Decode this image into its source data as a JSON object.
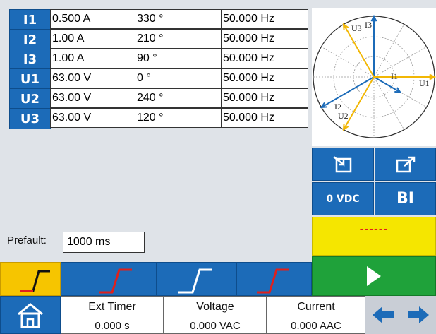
{
  "channels": [
    {
      "name": "I1",
      "magnitude": "0.500 A",
      "angle": "330 °",
      "frequency": "50.000 Hz"
    },
    {
      "name": "I2",
      "magnitude": "1.00 A",
      "angle": "210 °",
      "frequency": "50.000 Hz"
    },
    {
      "name": "I3",
      "magnitude": "1.00 A",
      "angle": "90 °",
      "frequency": "50.000 Hz"
    },
    {
      "name": "U1",
      "magnitude": "63.00 V",
      "angle": "0 °",
      "frequency": "50.000 Hz"
    },
    {
      "name": "U2",
      "magnitude": "63.00 V",
      "angle": "240 °",
      "frequency": "50.000 Hz"
    },
    {
      "name": "U3",
      "magnitude": "63.00 V",
      "angle": "120 °",
      "frequency": "50.000 Hz"
    }
  ],
  "phasor": {
    "labels": {
      "I1": "I1",
      "I2": "I2",
      "I3": "I3",
      "U1": "U1",
      "U2": "U2",
      "U3": "U3"
    },
    "current_color": "#1c6bb8",
    "voltage_color": "#f2b705"
  },
  "buttons": {
    "dc_label": "0 VDC",
    "bi_label": "BI",
    "status_indicator": "------",
    "import_icon": "import-icon",
    "export_icon": "export-icon",
    "play_icon": "play-icon"
  },
  "prefault": {
    "label": "Prefault:",
    "value": "1000 ms"
  },
  "status": {
    "timer_label": "Ext Timer",
    "timer_value": "0.000 s",
    "voltage_label": "Voltage",
    "voltage_value": "0.000 VAC",
    "current_label": "Current",
    "current_value": "0.000 AAC"
  },
  "icons": {
    "home": "home-icon",
    "left": "arrow-left-icon",
    "right": "arrow-right-icon"
  },
  "colors": {
    "accent": "#1c6bb8",
    "yellow": "#f5e600",
    "green": "#1fa23a",
    "selected_tab": "#f6c500",
    "ramp_red": "#e0201b"
  }
}
